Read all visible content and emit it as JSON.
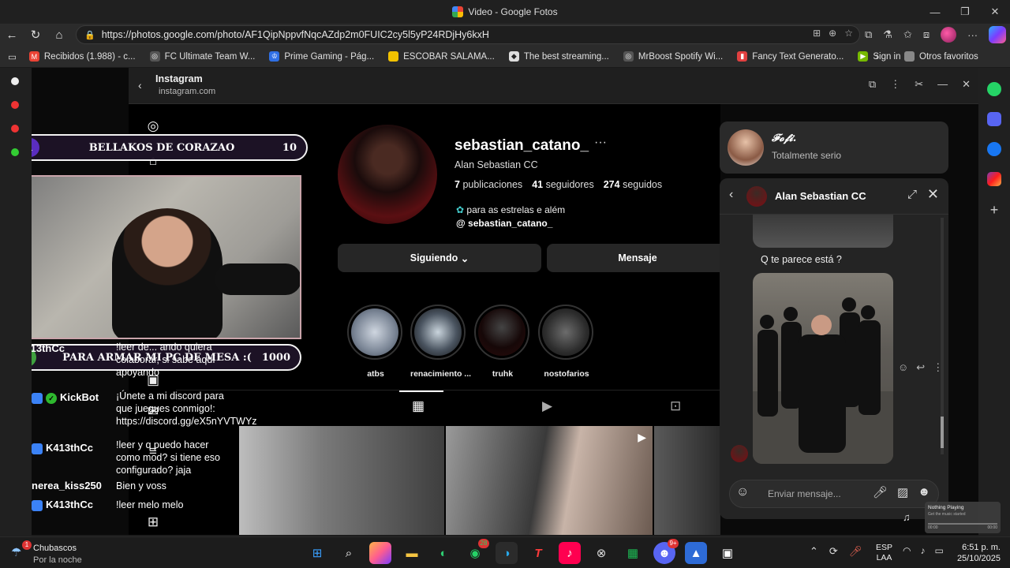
{
  "window": {
    "title": "Video - Google Fotos",
    "controls": [
      "—",
      "❐",
      "✕"
    ]
  },
  "address_bar": {
    "url": "https://photos.google.com/photo/AF1QipNppvfNqcAZdp2m0FUIC2cy5l5yP24RDjHy6kxH"
  },
  "bookmarks": [
    {
      "label": "Recibidos (1.988) - c...",
      "icon": "gmail-icon",
      "color": "#ea4335"
    },
    {
      "label": "FC Ultimate Team W...",
      "icon": "globe-icon",
      "color": "#555555"
    },
    {
      "label": "Prime Gaming - Pág...",
      "icon": "crown-icon",
      "color": "#2f6fe4"
    },
    {
      "label": "ESCOBAR SALAMA...",
      "icon": "doc-icon",
      "color": "#f2c200"
    },
    {
      "label": "The best streaming...",
      "icon": "diamond-icon",
      "color": "#dddddd"
    },
    {
      "label": "MrBoost Spotify Wi...",
      "icon": "globe-icon",
      "color": "#555555"
    },
    {
      "label": "Fancy Text Generato...",
      "icon": "bookmark-icon",
      "color": "#e04040"
    },
    {
      "label": "Sign in",
      "icon": "nvidia-icon",
      "color": "#76b900"
    }
  ],
  "bookmarks_more": "Otros favoritos",
  "ig_window": {
    "title": "Instagram",
    "domain": "instagram.com"
  },
  "profile": {
    "username": "sebastian_catano_",
    "fullname": "Alan Sebastian CC",
    "stats": [
      {
        "value": "7",
        "label": "publicaciones"
      },
      {
        "value": "41",
        "label": "seguidores"
      },
      {
        "value": "274",
        "label": "seguidos"
      }
    ],
    "bio_line": "para as estrelas e além",
    "threads_handle": "sebastian_catano_",
    "follow_button": "Siguiendo",
    "message_button": "Mensaje",
    "highlights": [
      "atbs",
      "renacimiento ...",
      "truhk",
      "nostofarios"
    ]
  },
  "notification": {
    "name": "𝓕𝓸𝓯𝓲.",
    "status": "Totalmente serio"
  },
  "chat": {
    "contact": "Alan Sebastian CC",
    "message_text": "Q te parece está ?",
    "input_placeholder": "Enviar mensaje..."
  },
  "overlay": {
    "goal1": {
      "rank": "1",
      "title": "BELLAKOS DE CORAZAO",
      "value": "10"
    },
    "goal2": {
      "rank": "0",
      "title": "PARA ARMAR MI PC DE MESA :(",
      "value": "1000"
    },
    "messages": [
      {
        "user": "K413thCc",
        "text": "!leer de... ando quiera colaborar, si sabe aquí apoyando"
      },
      {
        "user": "KickBot",
        "text": "¡Únete a mi discord para que juegues conmigo!: https://discord.gg/eX5nYVTWYz"
      },
      {
        "user": "K413thCc",
        "text": "!leer y q puedo hacer como mod? si tiene eso configurado? jaja"
      },
      {
        "user": "nerea_kiss250",
        "text": "Bien y voss"
      },
      {
        "user": "K413thCc",
        "text": "!leer melo melo"
      }
    ]
  },
  "music_widget": {
    "title": "Nothing Playing",
    "subtitle": "Get the music started",
    "time_start": "00:00",
    "time_end": "00:00"
  },
  "taskbar": {
    "weather_title": "Chubascos",
    "weather_sub": "Por la noche",
    "weather_badge": "1",
    "whatsapp_badge": "28",
    "discord_badge": "9+",
    "lang_top": "ESP",
    "lang_bottom": "LAA",
    "time": "6:51 p. m.",
    "date": "25/10/2025"
  }
}
